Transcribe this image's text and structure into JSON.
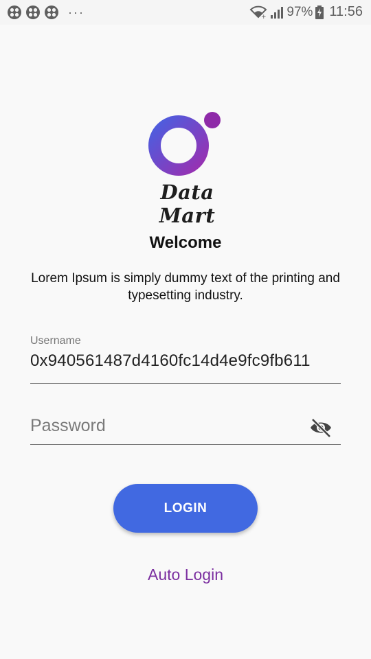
{
  "status_bar": {
    "dots": "···",
    "battery": "97%",
    "time": "11:56",
    "icons": [
      "app-notification-icon",
      "app-notification-icon",
      "app-notification-icon",
      "wifi-icon",
      "signal-icon",
      "battery-charging-icon"
    ]
  },
  "logo": {
    "text": "Data Mart",
    "colors": {
      "ring_start": "#4a5fe0",
      "ring_end": "#9b2fb0",
      "dot": "#8e2aa8"
    }
  },
  "welcome": {
    "title": "Welcome",
    "description": "Lorem Ipsum is simply dummy text of the printing and typesetting industry."
  },
  "form": {
    "username_label": "Username",
    "username_value": "0x940561487d4160fc14d4e9fc9fb611",
    "password_placeholder": "Password",
    "password_value": ""
  },
  "actions": {
    "login_label": "LOGIN",
    "auto_login_label": "Auto Login"
  },
  "theme": {
    "primary": "#4169e1",
    "link": "#7b2fa0",
    "background": "#f9f9f9"
  }
}
